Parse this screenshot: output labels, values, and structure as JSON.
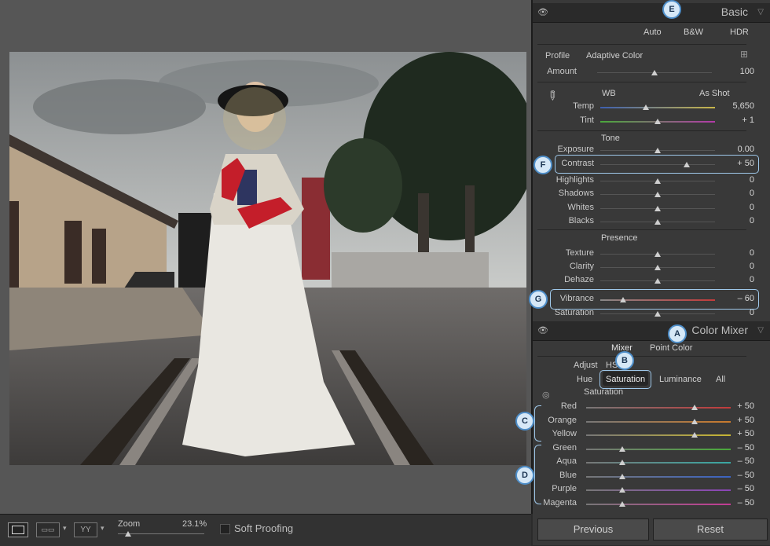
{
  "bottom": {
    "zoom_label": "Zoom",
    "zoom_value": "23.1%",
    "soft_proofing": "Soft Proofing",
    "zoom_fraction": 0.12
  },
  "basic": {
    "title": "Basic",
    "modes": [
      "Auto",
      "B&W",
      "HDR"
    ],
    "profile_label": "Profile",
    "profile_value": "Adaptive Color",
    "amount_label": "Amount",
    "amount_value": "100",
    "wb_label": "WB",
    "wb_value": "As Shot",
    "temp_label": "Temp",
    "temp_value": "5,650",
    "tint_label": "Tint",
    "tint_value": "+ 1",
    "tone_header": "Tone",
    "exposure_label": "Exposure",
    "exposure_value": "0.00",
    "contrast_label": "Contrast",
    "contrast_value": "+ 50",
    "highlights_label": "Highlights",
    "highlights_value": "0",
    "shadows_label": "Shadows",
    "shadows_value": "0",
    "whites_label": "Whites",
    "whites_value": "0",
    "blacks_label": "Blacks",
    "blacks_value": "0",
    "presence_header": "Presence",
    "texture_label": "Texture",
    "texture_value": "0",
    "clarity_label": "Clarity",
    "clarity_value": "0",
    "dehaze_label": "Dehaze",
    "dehaze_value": "0",
    "vibrance_label": "Vibrance",
    "vibrance_value": "– 60",
    "saturation_label": "Saturation",
    "saturation_value": "0"
  },
  "mixer": {
    "title": "Color Mixer",
    "tab_mixer": "Mixer",
    "tab_point": "Point Color",
    "adjust_label": "Adjust",
    "adjust_value": "HSL",
    "modes": [
      "Hue",
      "Saturation",
      "Luminance",
      "All"
    ],
    "sat_header": "Saturation",
    "channels": [
      {
        "label": "Red",
        "value": "+ 50",
        "level": 0.75,
        "color": "#c23b3b"
      },
      {
        "label": "Orange",
        "value": "+ 50",
        "level": 0.75,
        "color": "#c97a2c"
      },
      {
        "label": "Yellow",
        "value": "+ 50",
        "level": 0.75,
        "color": "#c7b533"
      },
      {
        "label": "Green",
        "value": "– 50",
        "level": 0.25,
        "color": "#4aa83b"
      },
      {
        "label": "Aqua",
        "value": "– 50",
        "level": 0.25,
        "color": "#39a8a3"
      },
      {
        "label": "Blue",
        "value": "– 50",
        "level": 0.25,
        "color": "#3b63c2"
      },
      {
        "label": "Purple",
        "value": "– 50",
        "level": 0.25,
        "color": "#8b44b8"
      },
      {
        "label": "Magenta",
        "value": "– 50",
        "level": 0.25,
        "color": "#c23b94"
      }
    ]
  },
  "buttons": {
    "previous": "Previous",
    "reset": "Reset"
  },
  "callouts": {
    "a": "A",
    "b": "B",
    "c": "C",
    "d": "D",
    "e": "E",
    "f": "F",
    "g": "G"
  },
  "levels": {
    "amount": 0.5,
    "temp": 0.4,
    "tint": 0.5,
    "exposure": 0.5,
    "contrast": 0.75,
    "highlights": 0.5,
    "shadows": 0.5,
    "whites": 0.5,
    "blacks": 0.5,
    "texture": 0.5,
    "clarity": 0.5,
    "dehaze": 0.5,
    "vibrance": 0.2,
    "saturation": 0.5
  }
}
